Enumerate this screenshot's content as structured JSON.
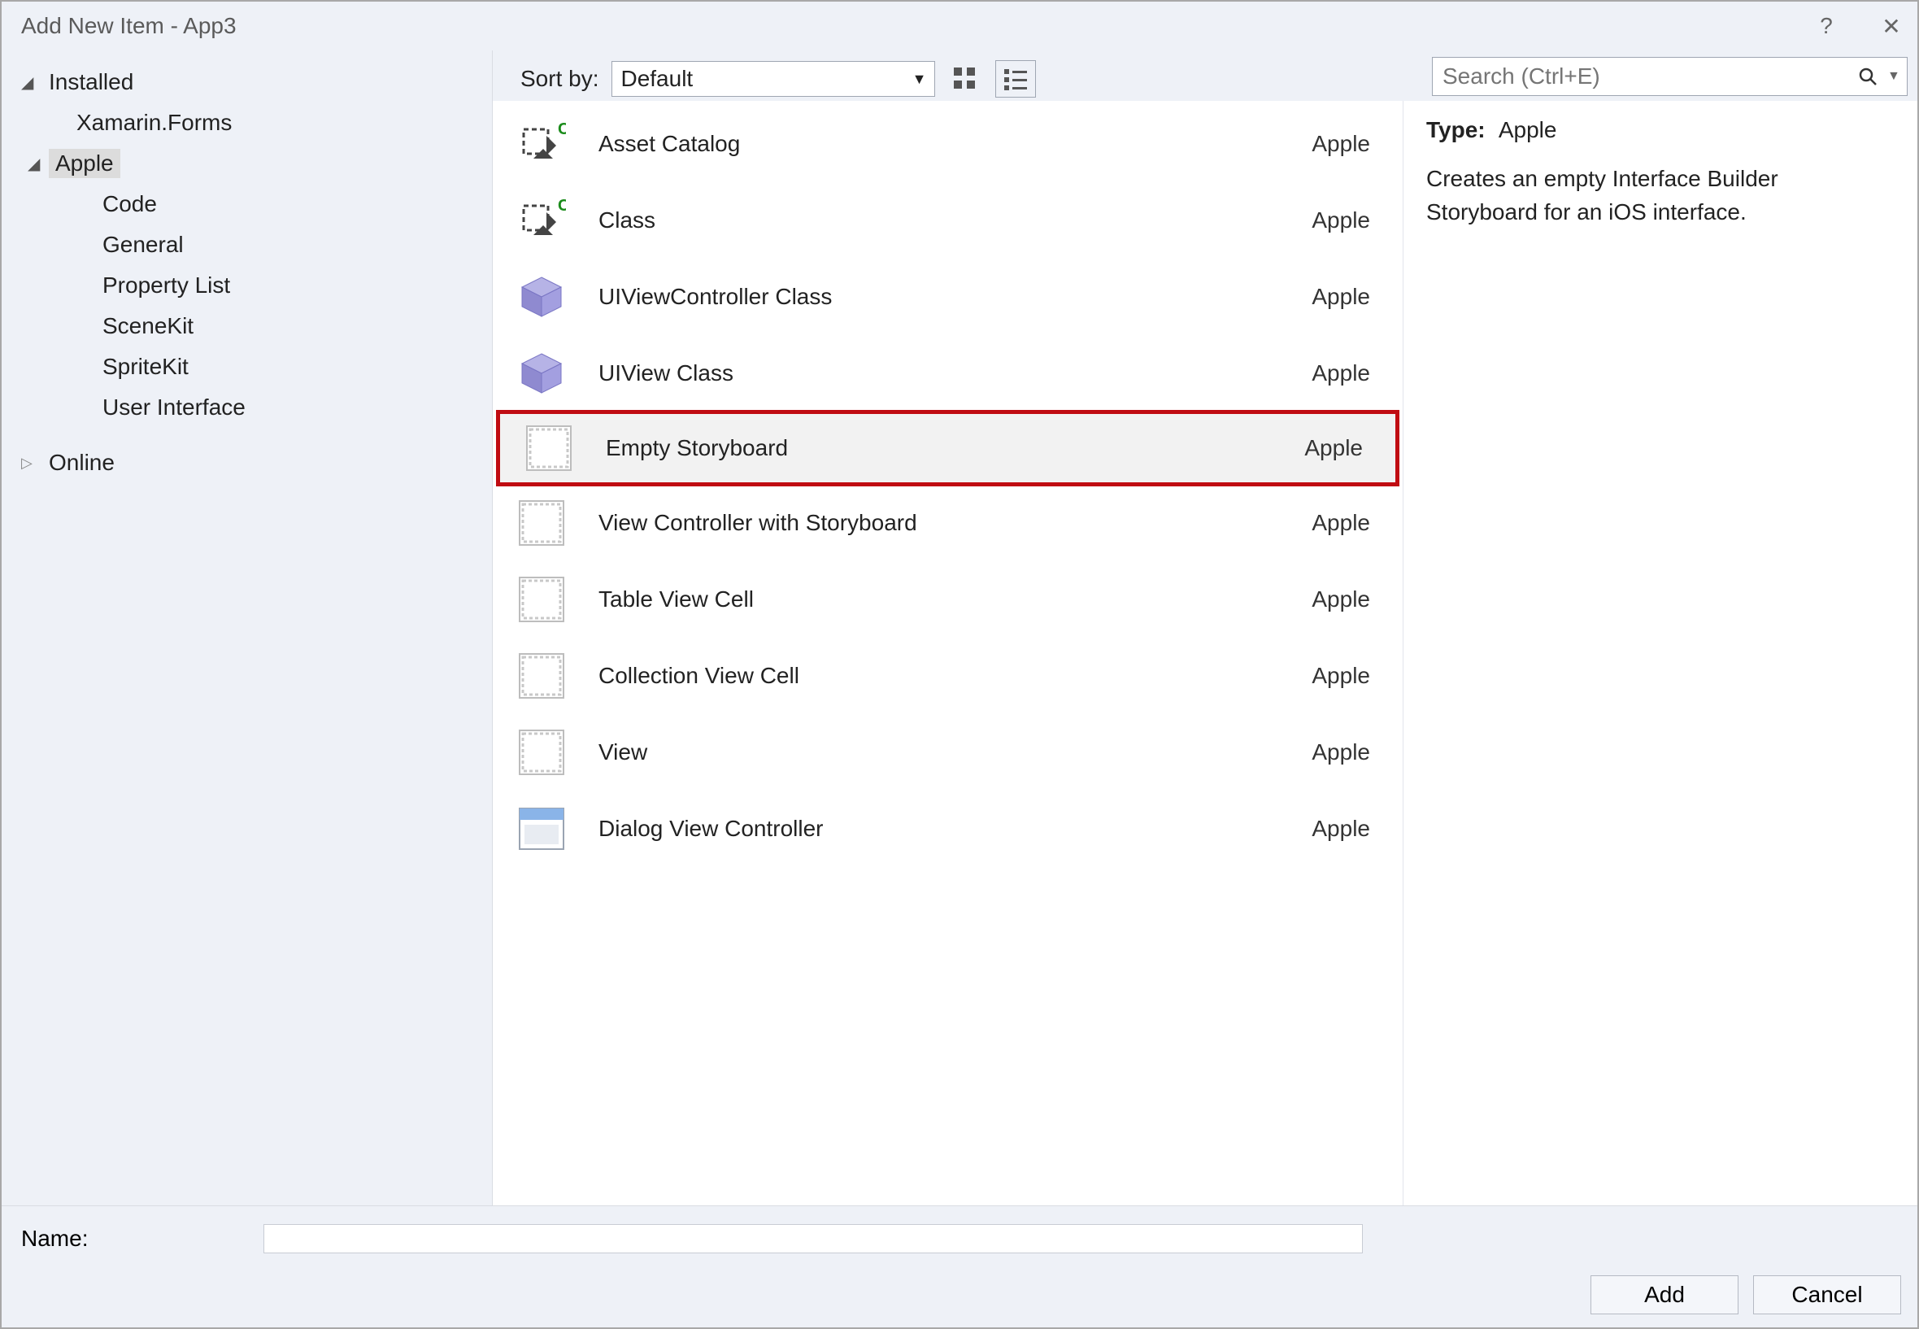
{
  "window": {
    "title": "Add New Item - App3"
  },
  "sidebar": {
    "root_installed": "Installed",
    "xamarin": "Xamarin.Forms",
    "apple": "Apple",
    "children": [
      "Code",
      "General",
      "Property List",
      "SceneKit",
      "SpriteKit",
      "User Interface"
    ],
    "online": "Online"
  },
  "toolbar": {
    "sort_label": "Sort by:",
    "sort_value": "Default"
  },
  "search": {
    "placeholder": "Search (Ctrl+E)"
  },
  "templates": [
    {
      "name": "Asset Catalog",
      "category": "Apple",
      "icon": "asset"
    },
    {
      "name": "Class",
      "category": "Apple",
      "icon": "asset"
    },
    {
      "name": "UIViewController Class",
      "category": "Apple",
      "icon": "cube"
    },
    {
      "name": "UIView Class",
      "category": "Apple",
      "icon": "cube"
    },
    {
      "name": "Empty Storyboard",
      "category": "Apple",
      "icon": "storyboard",
      "highlight": true
    },
    {
      "name": "View Controller with Storyboard",
      "category": "Apple",
      "icon": "storyboard"
    },
    {
      "name": "Table View Cell",
      "category": "Apple",
      "icon": "storyboard"
    },
    {
      "name": "Collection View Cell",
      "category": "Apple",
      "icon": "storyboard"
    },
    {
      "name": "View",
      "category": "Apple",
      "icon": "storyboard"
    },
    {
      "name": "Dialog View Controller",
      "category": "Apple",
      "icon": "dialog"
    }
  ],
  "details": {
    "type_label": "Type:",
    "type_value": "Apple",
    "description": "Creates an empty Interface Builder Storyboard for an iOS interface."
  },
  "footer": {
    "name_label": "Name:",
    "name_value": "",
    "add": "Add",
    "cancel": "Cancel"
  }
}
